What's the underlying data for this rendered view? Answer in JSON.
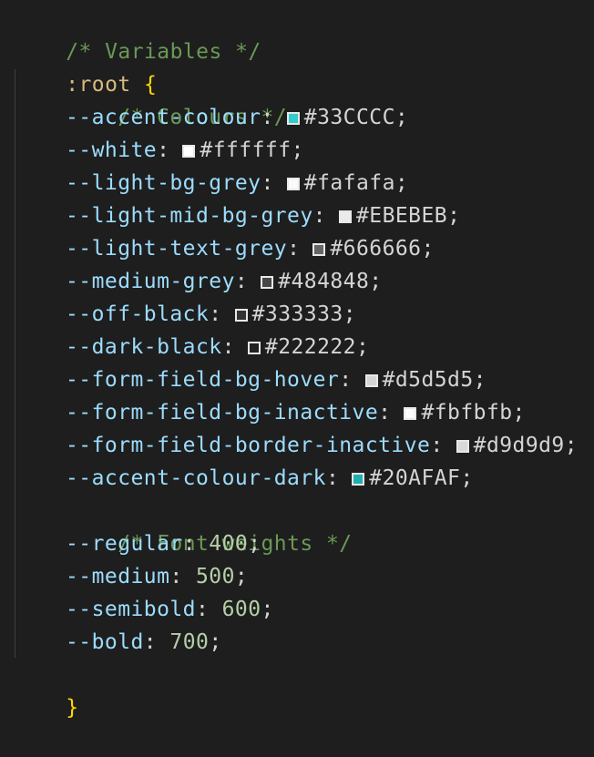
{
  "editor": {
    "header_comment": "/* Variables */",
    "selector": ":root",
    "open_brace": "{",
    "close_brace": "}",
    "colours_comment": "/* Colours */",
    "font_weights_comment": "/* Font weights */",
    "colour_vars": [
      {
        "name": "--accent-colour",
        "value": "#33CCCC",
        "swatch": "#33CCCC"
      },
      {
        "name": "--white",
        "value": "#ffffff",
        "swatch": "#ffffff"
      },
      {
        "name": "--light-bg-grey",
        "value": "#fafafa",
        "swatch": "#fafafa"
      },
      {
        "name": "--light-mid-bg-grey",
        "value": "#EBEBEB",
        "swatch": "#EBEBEB"
      },
      {
        "name": "--light-text-grey",
        "value": "#666666",
        "swatch": "#666666"
      },
      {
        "name": "--medium-grey",
        "value": "#484848",
        "swatch": "#484848"
      },
      {
        "name": "--off-black",
        "value": "#333333",
        "swatch": "#333333"
      },
      {
        "name": "--dark-black",
        "value": "#222222",
        "swatch": "#222222"
      },
      {
        "name": "--form-field-bg-hover",
        "value": "#d5d5d5",
        "swatch": "#d5d5d5"
      },
      {
        "name": "--form-field-bg-inactive",
        "value": "#fbfbfb",
        "swatch": "#fbfbfb"
      },
      {
        "name": "--form-field-border-inactive",
        "value": "#d9d9d9",
        "swatch": "#d9d9d9"
      },
      {
        "name": "--accent-colour-dark",
        "value": "#20AFAF",
        "swatch": "#20AFAF"
      }
    ],
    "weight_vars": [
      {
        "name": "--regular",
        "value": "400"
      },
      {
        "name": "--medium",
        "value": "500"
      },
      {
        "name": "--semibold",
        "value": "600"
      },
      {
        "name": "--bold",
        "value": "700"
      }
    ]
  }
}
